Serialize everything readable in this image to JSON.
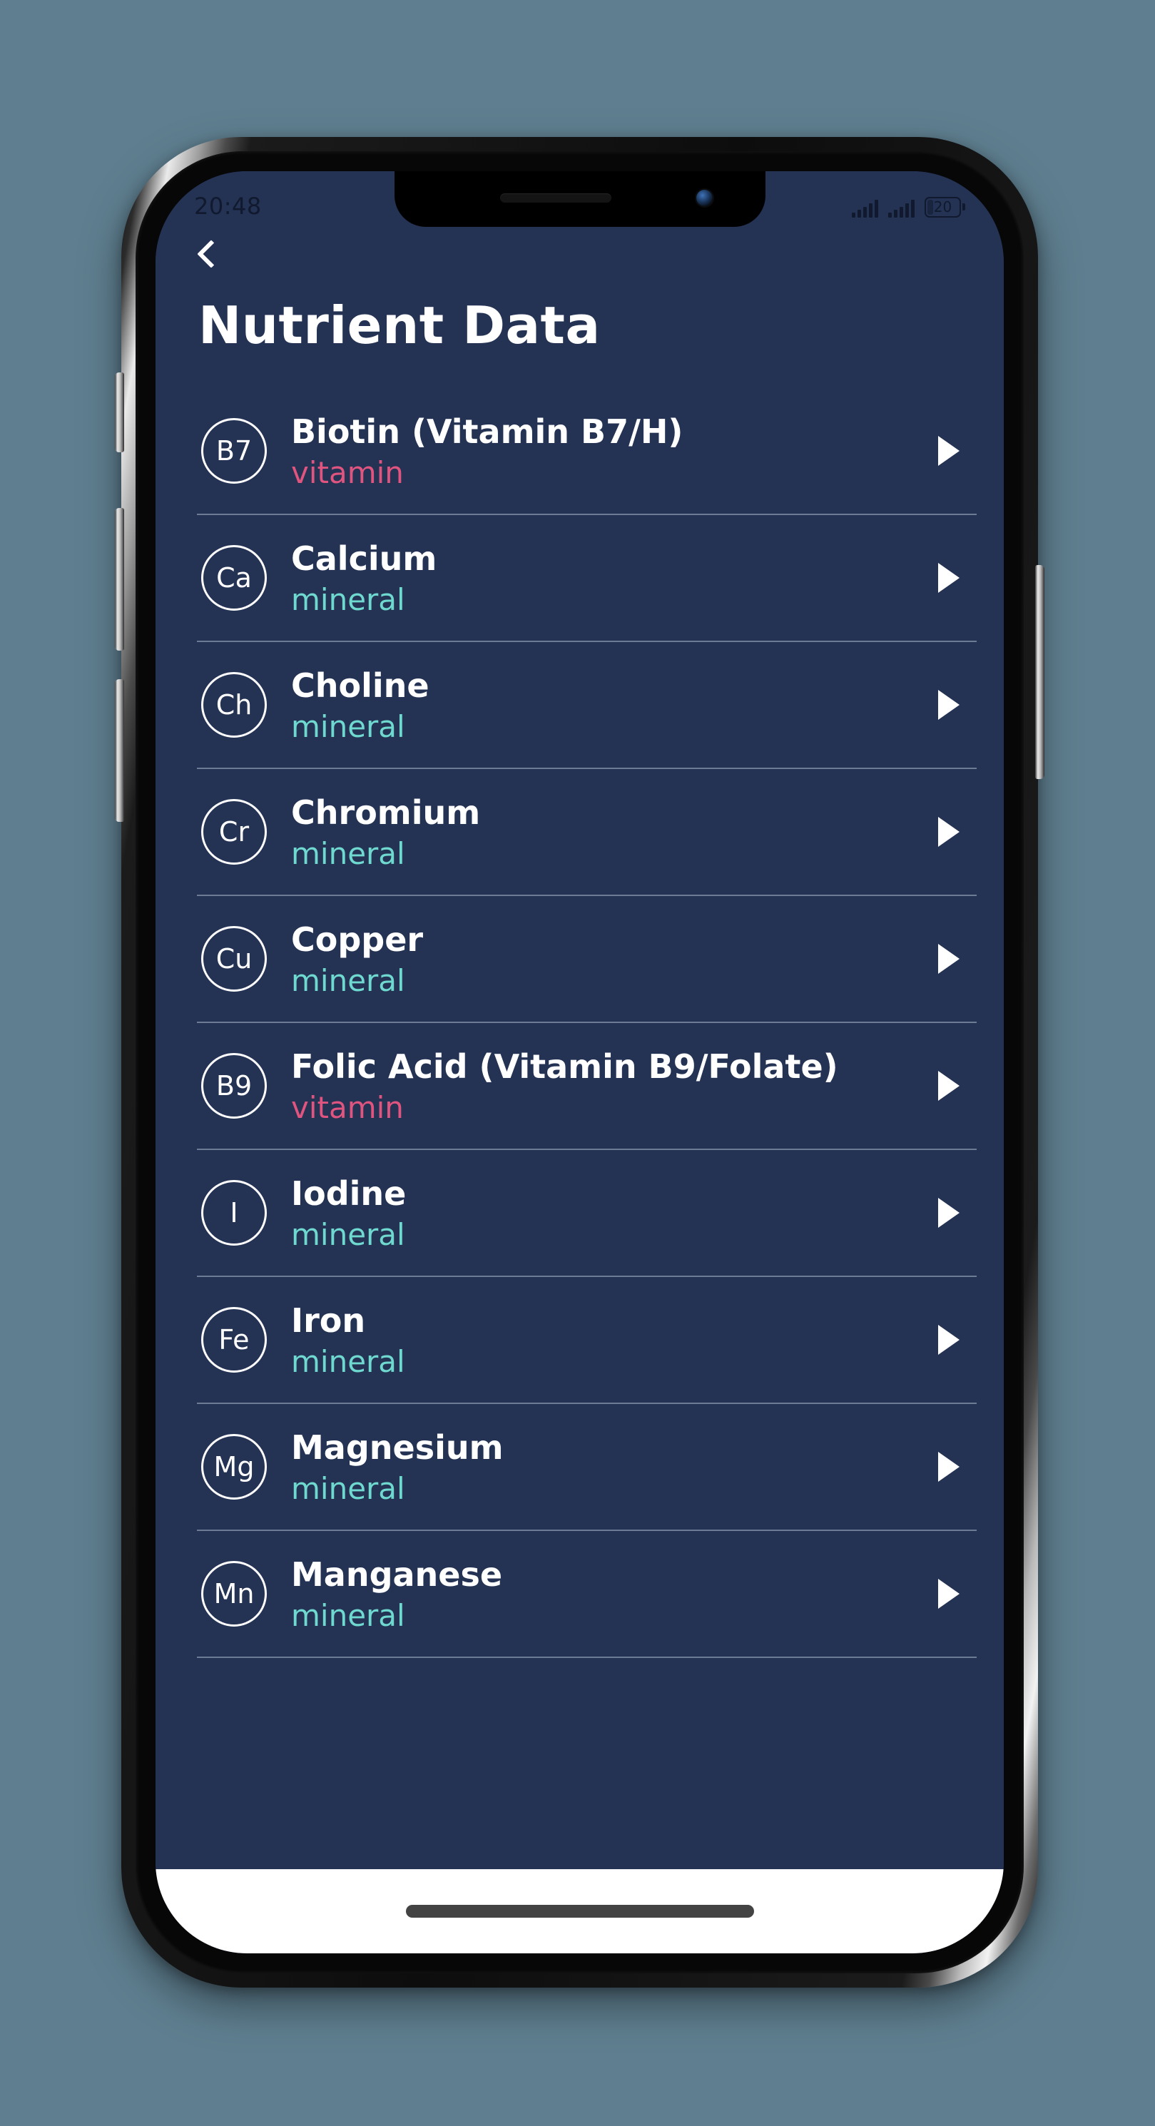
{
  "status_bar": {
    "time": "20:48",
    "signal_1_icon": "cellular-signal-icon",
    "signal_2_icon": "cellular-signal-icon",
    "battery_icon": "battery-icon",
    "battery_level": "20"
  },
  "nav": {
    "back_icon": "back-chevron-icon",
    "title": "Nutrient Data"
  },
  "list": {
    "items": [
      {
        "symbol": "B7",
        "name": "Biotin (Vitamin B7/H)",
        "type": "vitamin",
        "type_class": "type-vitamin"
      },
      {
        "symbol": "Ca",
        "name": "Calcium",
        "type": "mineral",
        "type_class": "type-mineral"
      },
      {
        "symbol": "Ch",
        "name": "Choline",
        "type": "mineral",
        "type_class": "type-mineral"
      },
      {
        "symbol": "Cr",
        "name": "Chromium",
        "type": "mineral",
        "type_class": "type-mineral"
      },
      {
        "symbol": "Cu",
        "name": "Copper",
        "type": "mineral",
        "type_class": "type-mineral"
      },
      {
        "symbol": "B9",
        "name": "Folic Acid (Vitamin B9/Folate)",
        "type": "vitamin",
        "type_class": "type-vitamin"
      },
      {
        "symbol": "I",
        "name": "Iodine",
        "type": "mineral",
        "type_class": "type-mineral"
      },
      {
        "symbol": "Fe",
        "name": "Iron",
        "type": "mineral",
        "type_class": "type-mineral"
      },
      {
        "symbol": "Mg",
        "name": "Magnesium",
        "type": "mineral",
        "type_class": "type-mineral"
      },
      {
        "symbol": "Mn",
        "name": "Manganese",
        "type": "mineral",
        "type_class": "type-mineral"
      }
    ]
  },
  "system": {
    "home_indicator_label": "home-indicator"
  },
  "colors": {
    "screen_background": "#243254",
    "page_background": "#5f7f90",
    "vitamin_accent": "#e0557f",
    "mineral_accent": "#6fd9cf",
    "divider": "#6e7b94",
    "text_primary": "#ffffff",
    "status_text": "#10192e"
  }
}
